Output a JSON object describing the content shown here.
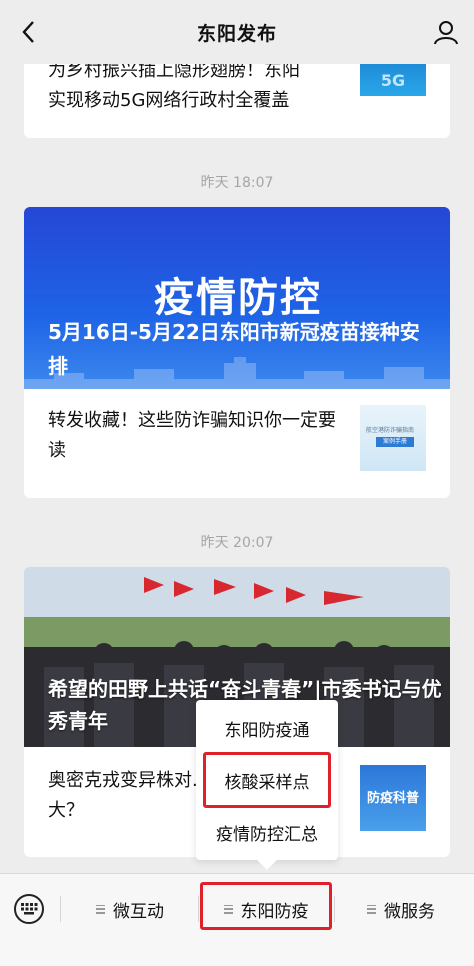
{
  "header": {
    "title": "东阳发布",
    "back_icon": "chevron-left-icon",
    "profile_icon": "user-icon"
  },
  "feed": {
    "article1": {
      "title_line1": "为乡村振兴插上隐形翅膀！东阳",
      "title_line2": "实现移动5G网络行政村全覆盖",
      "thumb_label": "5G"
    },
    "time1": "昨天 18:07",
    "article2": {
      "banner_title": "疫情防控",
      "banner_subtitle": "5月16日-5月22日东阳市新冠疫苗接种安排",
      "item_title": "转发收藏！这些防诈骗知识你一定要读",
      "thumb_caption": "航空港防诈骗指南",
      "thumb_badge": "案例手册"
    },
    "time2": "昨天 20:07",
    "article3": {
      "overlay_title": "希望的田野上共话“奋斗青春”|市委书记与优秀青年",
      "item_title": "奥密克戎变异株对... 是否依然很大？",
      "thumb_label": "防疫科普"
    }
  },
  "popup_menu": {
    "items": [
      "东阳防疫通",
      "核酸采样点",
      "疫情防控汇总"
    ],
    "highlighted": "核酸采样点"
  },
  "bottom_menu": {
    "keyboard_icon": "keyboard-icon",
    "items": [
      "微互动",
      "东阳防疫",
      "微服务"
    ],
    "highlighted": "东阳防疫"
  },
  "colors": {
    "background": "#ededed",
    "highlight": "#e0202a",
    "banner_blue": "#1e64e6"
  }
}
